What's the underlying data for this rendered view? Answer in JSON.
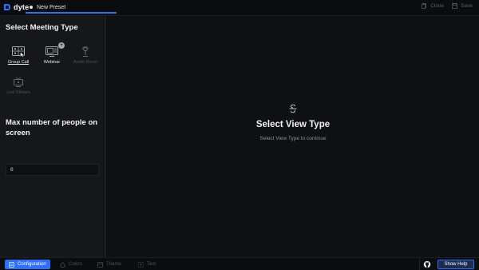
{
  "brand": {
    "name": "dyte"
  },
  "tab": {
    "label": "New Preset"
  },
  "top_actions": {
    "clone": "Clone",
    "save": "Save"
  },
  "sidebar": {
    "meeting_title": "Select Meeting Type",
    "meeting_types": [
      {
        "label": "Group Call",
        "icon": "group-call-icon",
        "state": "active"
      },
      {
        "label": "Webinar",
        "icon": "webinar-icon",
        "state": "enabled",
        "badge": "+"
      },
      {
        "label": "Audio Room",
        "icon": "audio-room-icon",
        "state": "disabled"
      },
      {
        "label": "Live Stream",
        "icon": "live-stream-icon",
        "state": "disabled"
      }
    ],
    "people_title": "Max number of people on screen",
    "people_value": "6"
  },
  "main": {
    "title": "Select View Type",
    "subtitle": "Select View Type to continue",
    "icon": "strikethrough-icon"
  },
  "bottom_tabs": [
    {
      "label": "Configuration",
      "icon": "configuration-icon",
      "active": true
    },
    {
      "label": "Colors",
      "icon": "colors-icon",
      "active": false
    },
    {
      "label": "Theme",
      "icon": "theme-icon",
      "active": false
    },
    {
      "label": "Text",
      "icon": "text-icon",
      "active": false
    }
  ],
  "help": {
    "label": "Show Help"
  },
  "colors": {
    "accent": "#2d6ff7",
    "background": "#0f1014",
    "sidebar": "#15171b"
  }
}
